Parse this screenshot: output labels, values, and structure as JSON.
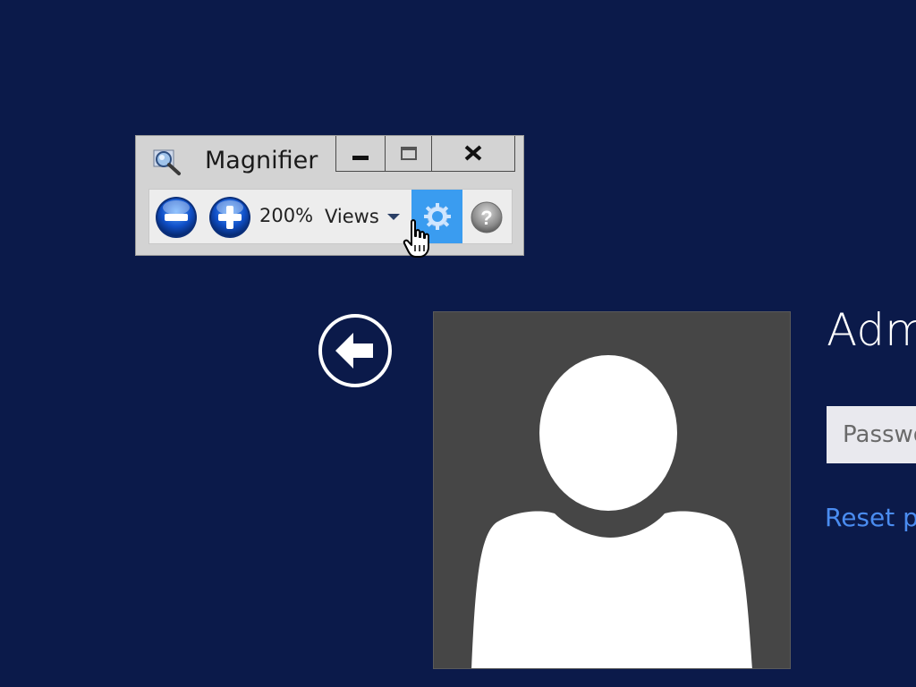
{
  "magnifier": {
    "title": "Magnifier",
    "app_icon": "magnifier-icon",
    "caption_buttons": {
      "minimize": "minimize-icon",
      "maximize": "maximize-icon",
      "close": "close-icon"
    },
    "toolbar": {
      "zoom_out_icon": "minus-icon",
      "zoom_in_icon": "plus-icon",
      "zoom_level": "200%",
      "views_label": "Views",
      "options_icon": "gear-icon",
      "help_icon": "help-icon"
    }
  },
  "lock_screen": {
    "back_icon": "back-arrow-icon",
    "avatar_icon": "user-silhouette-icon",
    "username": "Adm",
    "password_placeholder": "Passwo",
    "reset_link": "Reset pa"
  },
  "colors": {
    "background": "#0b1a4a",
    "accent": "#3a9cf0",
    "link": "#4a8cf0",
    "tile": "#464646"
  }
}
